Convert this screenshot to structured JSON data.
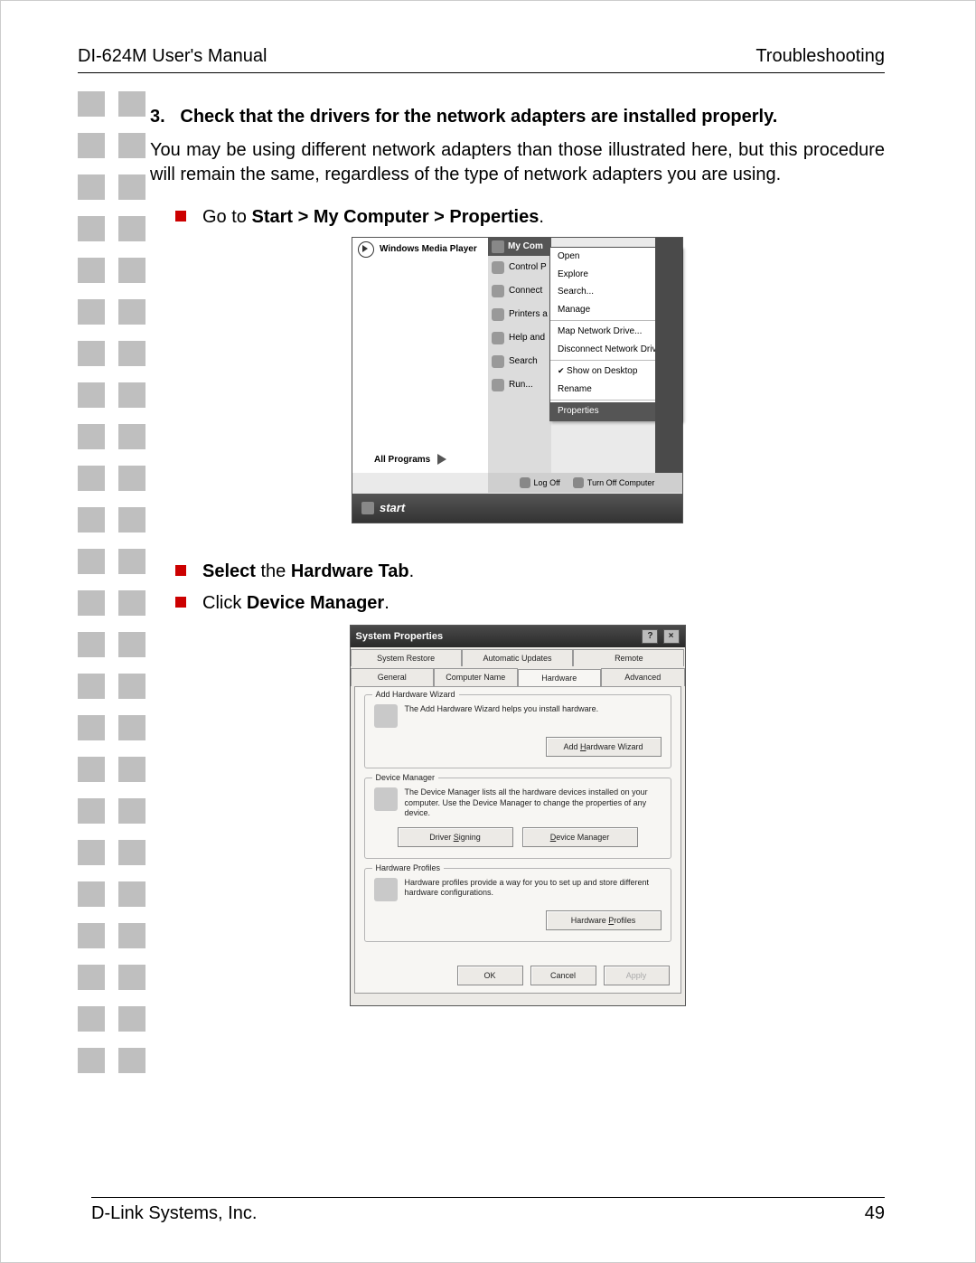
{
  "header": {
    "left": "DI-624M User's Manual",
    "right": "Troubleshooting"
  },
  "footer": {
    "left": "D-Link Systems, Inc.",
    "page": "49"
  },
  "step": {
    "num": "3.",
    "title": "Check that the drivers for the network adapters are installed properly.",
    "para": "You may be using different network adapters than those illustrated here, but this procedure will remain the same, regardless of the type of network adapters you are using."
  },
  "bullets": {
    "b1_pre": "Go to ",
    "b1_bold": "Start > My Computer > Properties",
    "b1_post": ".",
    "b2_bold1": "Select",
    "b2_mid": " the ",
    "b2_bold2": "Hardware Tab",
    "b2_post": ".",
    "b3_pre": "Click ",
    "b3_bold": "Device Manager",
    "b3_post": "."
  },
  "startmenu": {
    "wmp": "Windows Media Player",
    "my_computer": "My Com",
    "side": {
      "control_panel": "Control P",
      "connect": "Connect",
      "printers": "Printers a",
      "help": "Help and",
      "search": "Search",
      "run": "Run..."
    },
    "context": {
      "open": "Open",
      "explore": "Explore",
      "search": "Search...",
      "manage": "Manage",
      "map": "Map Network Drive...",
      "disconnect": "Disconnect Network Drive...",
      "show": "Show on Desktop",
      "rename": "Rename",
      "properties": "Properties"
    },
    "all_programs": "All Programs",
    "logoff": "Log Off",
    "turnoff": "Turn Off Computer",
    "start": "start"
  },
  "sysprops": {
    "title": "System Properties",
    "tabs_top": {
      "sr": "System Restore",
      "au": "Automatic Updates",
      "rm": "Remote"
    },
    "tabs_bot": {
      "gen": "General",
      "cn": "Computer Name",
      "hw": "Hardware",
      "adv": "Advanced"
    },
    "grp1": {
      "legend": "Add Hardware Wizard",
      "text": "The Add Hardware Wizard helps you install hardware.",
      "btn": "Add Hardware Wizard"
    },
    "grp2": {
      "legend": "Device Manager",
      "text": "The Device Manager lists all the hardware devices installed on your computer. Use the Device Manager to change the properties of any device.",
      "btn1": "Driver Signing",
      "btn2": "Device Manager"
    },
    "grp3": {
      "legend": "Hardware Profiles",
      "text": "Hardware profiles provide a way for you to set up and store different hardware configurations.",
      "btn": "Hardware Profiles"
    },
    "dlg": {
      "ok": "OK",
      "cancel": "Cancel",
      "apply": "Apply"
    }
  }
}
